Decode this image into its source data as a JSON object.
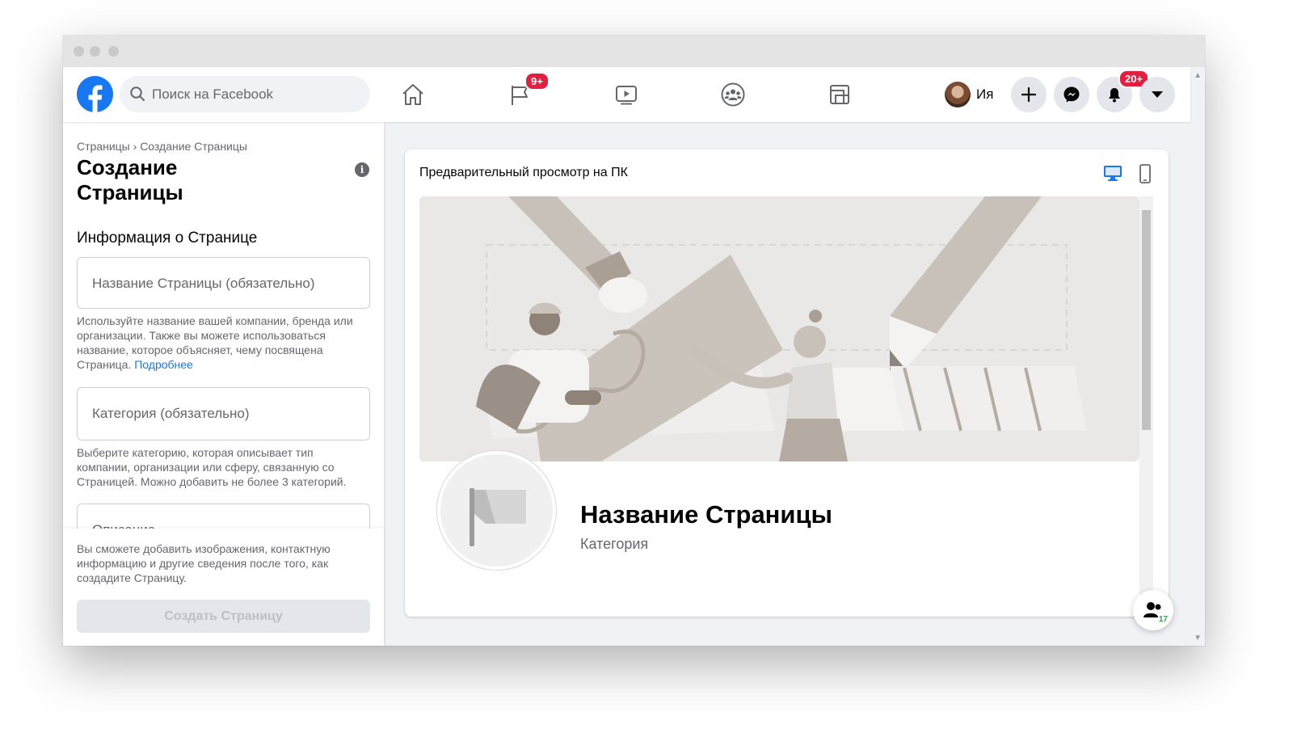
{
  "header": {
    "search_placeholder": "Поиск на Facebook",
    "pages_badge": "9+",
    "profile_name": "Ия",
    "notifications_badge": "20+"
  },
  "sidebar": {
    "breadcrumb_root": "Страницы",
    "breadcrumb_sep": "›",
    "breadcrumb_current": "Создание Страницы",
    "title": "Создание Страницы",
    "section_title": "Информация о Странице",
    "name_field_placeholder": "Название Страницы (обязательно)",
    "name_help": "Используйте название вашей компании, бренда или организации. Также вы можете использоваться название, которое объясняет, чему посвящена Страница.",
    "name_help_link": "Подробнее",
    "category_field_placeholder": "Категория (обязательно)",
    "category_help": "Выберите категорию, которая описывает тип компании, организации или сферу, связанную со Страницей. Можно добавить не более 3 категорий.",
    "description_field_placeholder": "Описание",
    "bottom_note": "Вы сможете добавить изображения, контактную информацию и другие сведения после того, как создадите Страницу.",
    "create_button": "Создать Страницу"
  },
  "preview": {
    "title": "Предварительный просмотр на ПК",
    "page_name": "Название Страницы",
    "page_category": "Категория"
  },
  "contacts": {
    "count": "17"
  },
  "colors": {
    "brand": "#1877f2",
    "badge": "#e41e3f",
    "online": "#31a24c"
  }
}
